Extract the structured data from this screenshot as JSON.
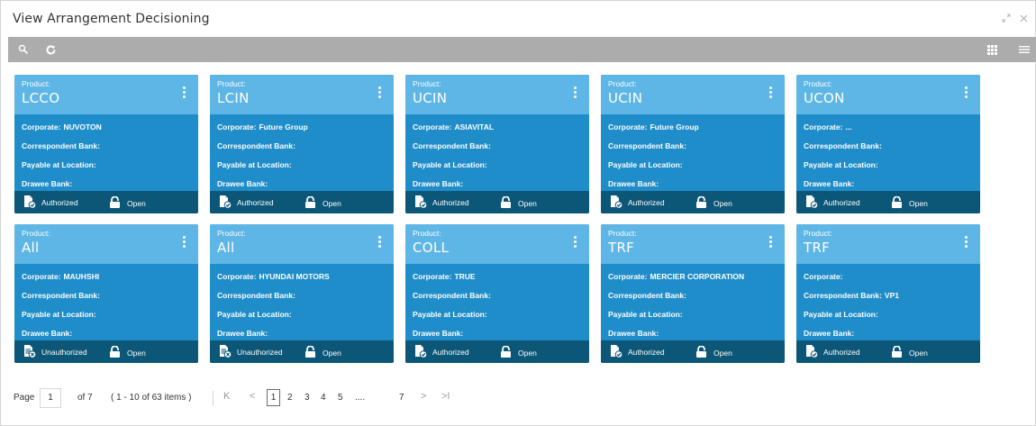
{
  "window": {
    "title": "View Arrangement Decisioning"
  },
  "cards": [
    {
      "product_label": "Product:",
      "product": "LCCO",
      "corporate_label": "Corporate:",
      "corporate": "NUVOTON",
      "correspondent_label": "Correspondent Bank:",
      "correspondent": "",
      "payable_label": "Payable at Location:",
      "payable": "",
      "drawee_label": "Drawee Bank:",
      "drawee": "",
      "status": "Authorized",
      "lock_status": "Open"
    },
    {
      "product_label": "Product:",
      "product": "LCIN",
      "corporate_label": "Corporate:",
      "corporate": "Future Group",
      "correspondent_label": "Correspondent Bank:",
      "correspondent": "",
      "payable_label": "Payable at Location:",
      "payable": "",
      "drawee_label": "Drawee Bank:",
      "drawee": "",
      "status": "Authorized",
      "lock_status": "Open"
    },
    {
      "product_label": "Product:",
      "product": "UCIN",
      "corporate_label": "Corporate:",
      "corporate": "ASIAVITAL",
      "correspondent_label": "Correspondent Bank:",
      "correspondent": "",
      "payable_label": "Payable at Location:",
      "payable": "",
      "drawee_label": "Drawee Bank:",
      "drawee": "",
      "status": "Authorized",
      "lock_status": "Open"
    },
    {
      "product_label": "Product:",
      "product": "UCIN",
      "corporate_label": "Corporate:",
      "corporate": "Future Group",
      "correspondent_label": "Correspondent Bank:",
      "correspondent": "",
      "payable_label": "Payable at Location:",
      "payable": "",
      "drawee_label": "Drawee Bank:",
      "drawee": "",
      "status": "Authorized",
      "lock_status": "Open"
    },
    {
      "product_label": "Product:",
      "product": "UCON",
      "corporate_label": "Corporate:",
      "corporate": "...",
      "correspondent_label": "Correspondent Bank:",
      "correspondent": "",
      "payable_label": "Payable at Location:",
      "payable": "",
      "drawee_label": "Drawee Bank:",
      "drawee": "",
      "status": "Authorized",
      "lock_status": "Open"
    },
    {
      "product_label": "Product:",
      "product": "All",
      "corporate_label": "Corporate:",
      "corporate": "MAUHSHI",
      "correspondent_label": "Correspondent Bank:",
      "correspondent": "",
      "payable_label": "Payable at Location:",
      "payable": "",
      "drawee_label": "Drawee Bank:",
      "drawee": "",
      "status": "Unauthorized",
      "lock_status": "Open"
    },
    {
      "product_label": "Product:",
      "product": "All",
      "corporate_label": "Corporate:",
      "corporate": "HYUNDAI MOTORS",
      "correspondent_label": "Correspondent Bank:",
      "correspondent": "",
      "payable_label": "Payable at Location:",
      "payable": "",
      "drawee_label": "Drawee Bank:",
      "drawee": "",
      "status": "Unauthorized",
      "lock_status": "Open"
    },
    {
      "product_label": "Product:",
      "product": "COLL",
      "corporate_label": "Corporate:",
      "corporate": "TRUE",
      "correspondent_label": "Correspondent Bank:",
      "correspondent": "",
      "payable_label": "Payable at Location:",
      "payable": "",
      "drawee_label": "Drawee Bank:",
      "drawee": "",
      "status": "Authorized",
      "lock_status": "Open"
    },
    {
      "product_label": "Product:",
      "product": "TRF",
      "corporate_label": "Corporate:",
      "corporate": "MERCIER CORPORATION",
      "correspondent_label": "Correspondent Bank:",
      "correspondent": "",
      "payable_label": "Payable at Location:",
      "payable": "",
      "drawee_label": "Drawee Bank:",
      "drawee": "",
      "status": "Authorized",
      "lock_status": "Open"
    },
    {
      "product_label": "Product:",
      "product": "TRF",
      "corporate_label": "Corporate:",
      "corporate": "",
      "correspondent_label": "Correspondent Bank:",
      "correspondent": "VP1",
      "payable_label": "Payable at Location:",
      "payable": "",
      "drawee_label": "Drawee Bank:",
      "drawee": "",
      "status": "Authorized",
      "lock_status": "Open"
    }
  ],
  "pager": {
    "page_label": "Page",
    "page_value": "1",
    "of_text": "of 7",
    "items_text": "( 1 - 10 of 63 items )",
    "first_glyph": "K",
    "prev_glyph": "<",
    "next_glyph": ">",
    "last_glyph": ">I",
    "pages": [
      "1",
      "2",
      "3",
      "4",
      "5",
      "....",
      "7"
    ]
  },
  "colors": {
    "card_body": "#1f8dc9",
    "card_head": "#5eb6e6",
    "card_foot": "#0c5677",
    "toolbar": "#acacac"
  },
  "icons": {
    "search": "search-icon",
    "refresh": "refresh-icon",
    "grid_view": "grid-view-icon",
    "list_view": "list-view-icon",
    "resize": "resize-icon",
    "close": "close-icon",
    "kebab": "kebab-menu-icon",
    "authorized": "authorized-document-icon",
    "unauthorized": "unauthorized-document-icon",
    "lock": "unlock-icon"
  }
}
